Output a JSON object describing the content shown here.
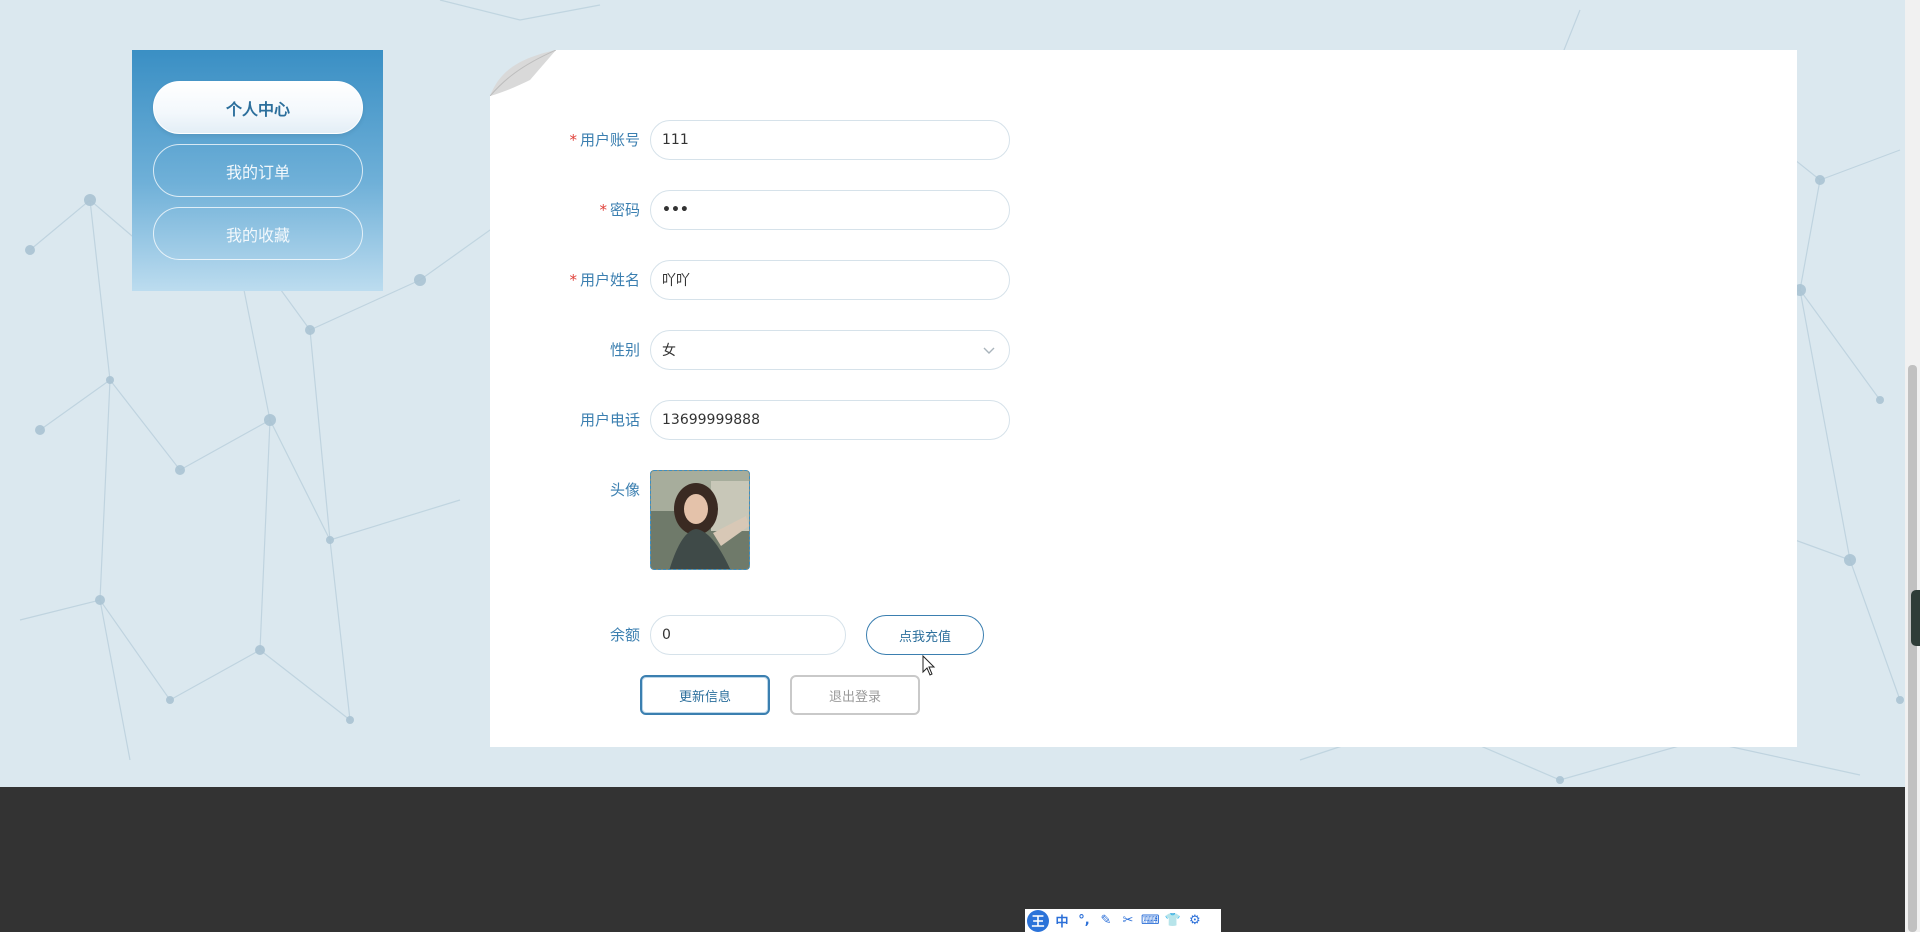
{
  "menu": {
    "items": [
      {
        "label": "个人中心",
        "active": true
      },
      {
        "label": "我的订单",
        "active": false
      },
      {
        "label": "我的收藏",
        "active": false
      }
    ]
  },
  "form": {
    "account": {
      "label": "用户账号",
      "required": true,
      "value": "111"
    },
    "password": {
      "label": "密码",
      "required": true,
      "value": "•••"
    },
    "name": {
      "label": "用户姓名",
      "required": true,
      "value": "吖吖"
    },
    "gender": {
      "label": "性别",
      "value": "女"
    },
    "phone": {
      "label": "用户电话",
      "value": "13699999888"
    },
    "avatar": {
      "label": "头像"
    },
    "balance": {
      "label": "余额",
      "value": "0"
    }
  },
  "buttons": {
    "recharge": "点我充值",
    "update": "更新信息",
    "logout": "退出登录"
  },
  "required_mark": "*",
  "ime": {
    "logo": "王",
    "items": [
      "中",
      "°,",
      "✎",
      "✂",
      "⌨",
      "👕",
      "⚙"
    ]
  },
  "colors": {
    "accent": "#3b7fb0",
    "required": "#e0413a",
    "footer": "#333333"
  }
}
